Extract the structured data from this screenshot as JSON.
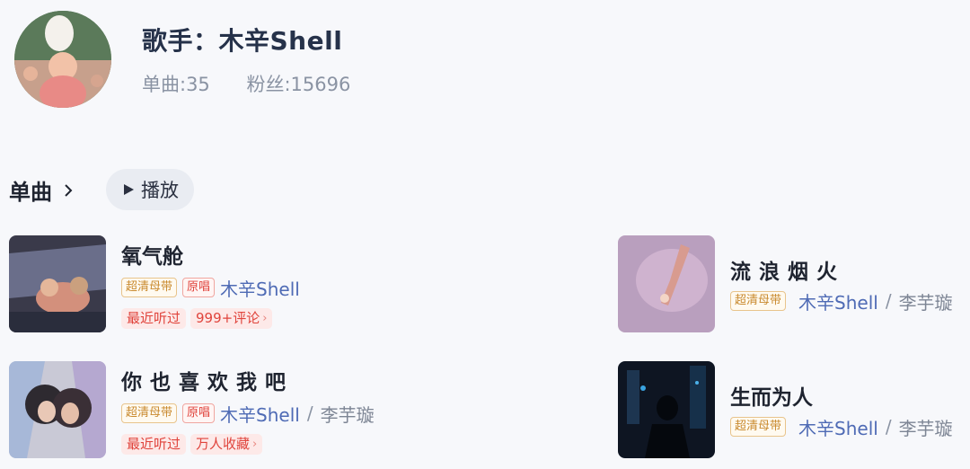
{
  "header": {
    "title": "歌手：木辛Shell",
    "singles_stat": "单曲:35",
    "fans_stat": "粉丝:15696"
  },
  "section": {
    "title": "单曲",
    "play_label": "播放"
  },
  "songs": [
    {
      "title": "氧气舱",
      "tags": [
        "超清母带",
        "原唱"
      ],
      "artist": "木辛Shell",
      "badges": [
        "最近听过",
        "999+评论"
      ]
    },
    {
      "title": "你也喜欢我吧",
      "tags": [
        "超清母带",
        "原唱"
      ],
      "artist": "木辛Shell",
      "artist2": "李芋璇",
      "badges": [
        "最近听过",
        "万人收藏"
      ]
    },
    {
      "title": "流浪烟火",
      "tags": [
        "超清母带"
      ],
      "artist": "木辛Shell",
      "artist2": "李芋璇"
    },
    {
      "title": "生而为人",
      "tags": [
        "超清母带"
      ],
      "artist": "木辛Shell",
      "artist2": "李芋璇"
    }
  ],
  "colors": {
    "background": "#f7f8fb",
    "artist_link": "#4f6bb5",
    "tag_gold": "#c98a2e",
    "badge_red": "#e0443c"
  }
}
